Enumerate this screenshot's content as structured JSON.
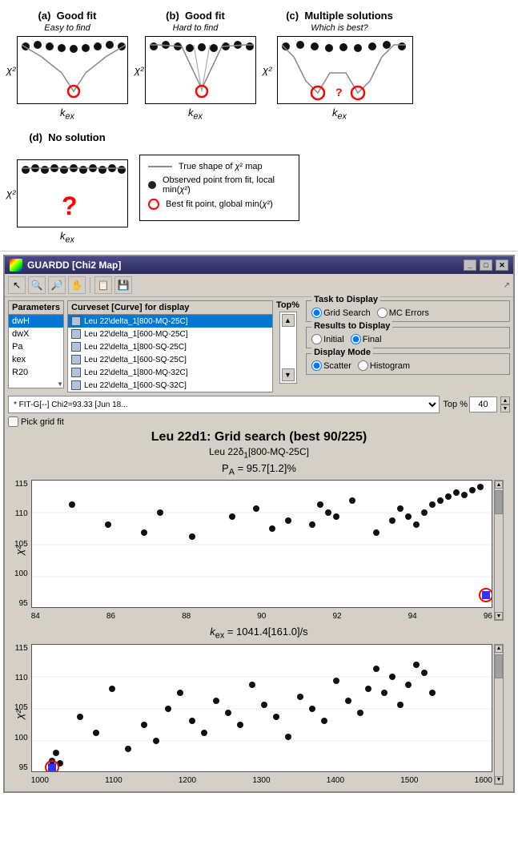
{
  "top_diagrams": {
    "panels": [
      {
        "id": "a",
        "label": "(a)",
        "title": "Good fit",
        "subtitle": "Easy to find",
        "type": "single_valley"
      },
      {
        "id": "b",
        "label": "(b)",
        "title": "Good fit",
        "subtitle": "Hard to find",
        "type": "flat_valley"
      },
      {
        "id": "c",
        "label": "(c)",
        "title": "Multiple solutions",
        "subtitle": "Which is best?",
        "type": "double_valley"
      },
      {
        "id": "d",
        "label": "(d)",
        "title": "No solution",
        "subtitle": "",
        "type": "flat"
      }
    ],
    "axis_x": "k_ex",
    "axis_y": "χ²"
  },
  "legend": {
    "items": [
      {
        "type": "line",
        "label": "True shape of χ² map"
      },
      {
        "type": "dot",
        "label": "Observed point from fit, local min(χ²)"
      },
      {
        "type": "circle",
        "label": "Best fit point, global min(χ²)"
      }
    ]
  },
  "app": {
    "title": "GUARDD [Chi2 Map]",
    "toolbar_icons": [
      "arrow",
      "zoom-in",
      "zoom-out",
      "pan",
      "separator",
      "copy",
      "save"
    ],
    "parameters": {
      "header": "Parameters",
      "items": [
        "dwH",
        "dwX",
        "Pa",
        "kex",
        "R20"
      ],
      "selected": "dwH"
    },
    "curveset": {
      "header": "Curveset [Curve] for display",
      "items": [
        {
          "color": "#b0c4de",
          "text": "Leu 22\\delta_1[800-MQ-25C]"
        },
        {
          "color": "#b0c4de",
          "text": "Leu 22\\delta_1[600-MQ-25C]"
        },
        {
          "color": "#b0c4de",
          "text": "Leu 22\\delta_1[800-SQ-25C]"
        },
        {
          "color": "#b0c4de",
          "text": "Leu 22\\delta_1[600-SQ-25C]"
        },
        {
          "color": "#b0c4de",
          "text": "Leu 22\\delta_1[800-MQ-32C]"
        },
        {
          "color": "#b0c4de",
          "text": "Leu 22\\delta_1[600-SQ-32C]"
        }
      ],
      "selected": 0
    },
    "top_pct": {
      "header": "Top%",
      "value": "40"
    },
    "task_display": {
      "title": "Task to Display",
      "options": [
        "Grid Search",
        "MC Errors"
      ],
      "selected": "Grid Search"
    },
    "results_display": {
      "title": "Results to Display",
      "options": [
        "Initial",
        "Final"
      ],
      "selected": "Final"
    },
    "display_mode": {
      "title": "Display Mode",
      "options": [
        "Scatter",
        "Histogram"
      ],
      "selected": "Scatter"
    },
    "fit_info": "* FIT-G[--] Chi2=93.33 [Jun 18...",
    "top_pct_label": "Top %",
    "top_pct_value": "40",
    "pick_grid_fit": "Pick grid fit",
    "main_title": "Leu 22d1: Grid search (best 90/225)",
    "plot1": {
      "subtitle": "Leu 22δ₁[800-MQ-25C]",
      "equation": "P_A = 95.7[1.2]%",
      "x_ticks": [
        "84",
        "86",
        "88",
        "90",
        "92",
        "94",
        "96"
      ],
      "y_ticks": [
        "95",
        "100",
        "105",
        "110",
        "115"
      ],
      "y_label": "χ²",
      "highlight_x": 96,
      "highlight_y": 95
    },
    "plot2": {
      "subtitle": "",
      "equation": "k_ex = 1041.4[161.0]/s",
      "x_ticks": [
        "1000",
        "1100",
        "1200",
        "1300",
        "1400",
        "1500",
        "1600"
      ],
      "y_ticks": [
        "95",
        "100",
        "105",
        "110",
        "115"
      ],
      "y_label": "χ²",
      "highlight_x": 1041,
      "highlight_y": 95
    }
  }
}
